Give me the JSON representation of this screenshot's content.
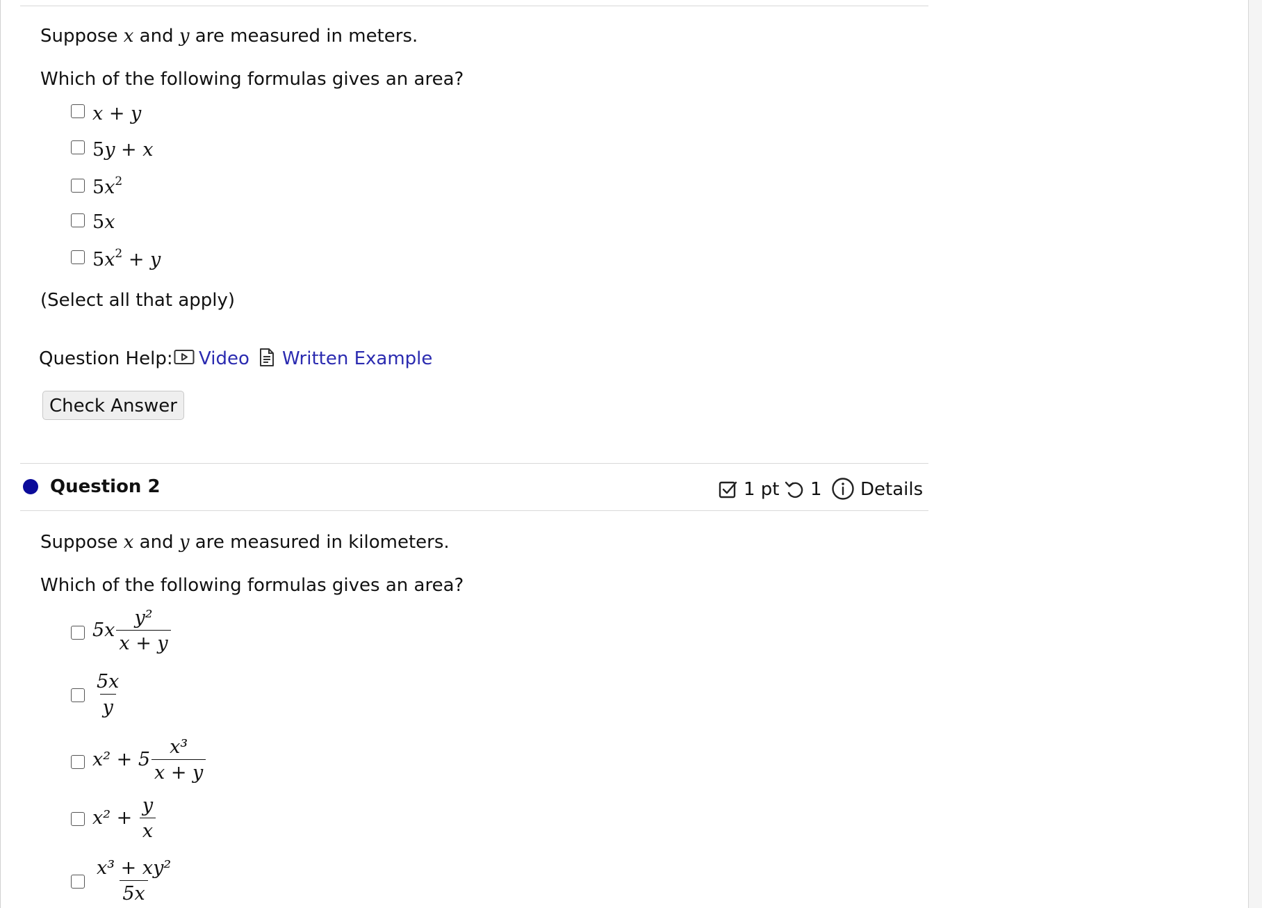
{
  "question1": {
    "prompt_pre": "Suppose ",
    "var_x": "x",
    "and_text": " and ",
    "var_y": "y",
    "prompt_post": " are measured in meters.",
    "question_text": "Which of the following formulas gives an area?",
    "options": [
      {
        "a": "x",
        "b": " + ",
        "c": "y"
      },
      {
        "a": "5",
        "b": "y",
        "c": " + ",
        "d": "x"
      },
      {
        "a": "5",
        "b": "x",
        "exp": "2"
      },
      {
        "a": "5",
        "b": "x"
      },
      {
        "a": "5",
        "b": "x",
        "exp": "2",
        "c": " + ",
        "d": "y"
      }
    ],
    "instruction": "(Select all that apply)",
    "help_label": "Question Help:",
    "help_video": "Video",
    "help_written": "Written Example",
    "check_button": "Check Answer"
  },
  "question2": {
    "title": "Question 2",
    "points": "1 pt",
    "attempts": "1",
    "details": "Details",
    "dot_color": "#0b0b9a",
    "prompt_pre": "Suppose ",
    "var_x": "x",
    "and_text": " and ",
    "var_y": "y",
    "prompt_post": " are measured in kilometers.",
    "question_text": "Which of the following formulas gives an area?",
    "options": [
      {
        "pre": "5x",
        "num": "y²",
        "den": "x + y"
      },
      {
        "num": "5x",
        "den": "y"
      },
      {
        "pre": "x² + 5",
        "num": "x³",
        "den": "x + y"
      },
      {
        "pre": "x² + ",
        "num": "y",
        "den": "x"
      },
      {
        "num": "x³ + xy²",
        "den": "5x"
      }
    ]
  },
  "icons": [
    "video-icon",
    "document-icon",
    "checkbox-points-icon",
    "retry-icon",
    "info-icon"
  ],
  "colors": {
    "link": "#2b2bb0",
    "dot": "#0b0b9a"
  }
}
